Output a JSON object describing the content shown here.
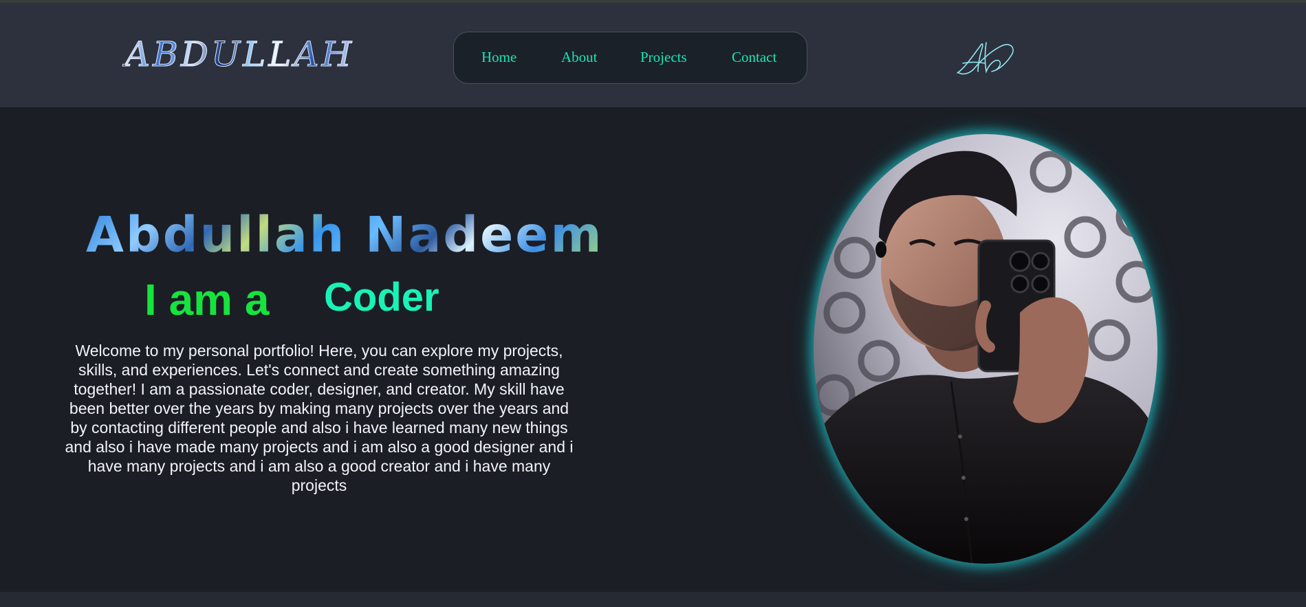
{
  "header": {
    "logo_text": "ABDULLAH",
    "signature_text": "Ab",
    "nav": [
      {
        "label": "Home"
      },
      {
        "label": "About"
      },
      {
        "label": "Projects"
      },
      {
        "label": "Contact"
      }
    ]
  },
  "hero": {
    "name": "Abdullah Nadeem",
    "prefix": "I am a",
    "role": "Coder",
    "intro": "Welcome to my personal portfolio! Here, you can explore my projects, skills, and experiences. Let's connect and create something amazing together! I am a passionate coder, designer, and creator. My skill have been better over the years by making many projects over the years and by contacting different people and also i have learned many new things and also i have made many projects and i am also a good designer and i have many projects and i am also a good creator and i have many projects"
  },
  "colors": {
    "page_bg": "#1b1e25",
    "header_bg": "#2c313d",
    "nav_link": "#19e6b8",
    "prefix_green": "#17e33d",
    "role_teal": "#19f2b6",
    "photo_glow": "#20d2d6"
  }
}
